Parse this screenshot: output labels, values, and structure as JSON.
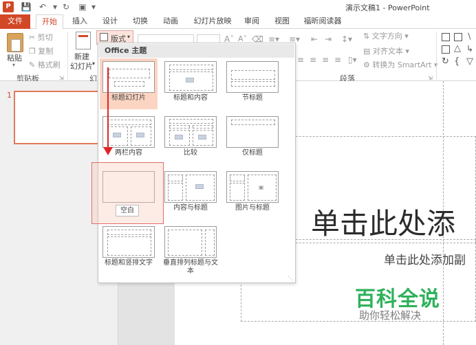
{
  "app": {
    "logo_letter": "P",
    "window_title": "演示文稿1 - PowerPoint",
    "brand_color": "#d24726"
  },
  "quick_access": {
    "save_icon": "save-icon",
    "undo_icon": "undo-icon",
    "redo_icon": "redo-icon",
    "present_icon": "start-from-beginning-icon"
  },
  "tabs": [
    {
      "label": "文件"
    },
    {
      "label": "开始"
    },
    {
      "label": "插入"
    },
    {
      "label": "设计"
    },
    {
      "label": "切换"
    },
    {
      "label": "动画"
    },
    {
      "label": "幻灯片放映"
    },
    {
      "label": "审阅"
    },
    {
      "label": "视图"
    },
    {
      "label": "福昕阅读器"
    }
  ],
  "ribbon": {
    "clipboard": {
      "paste_label": "粘贴",
      "cut_label": "剪切",
      "copy_label": "复制",
      "format_painter_label": "格式刷",
      "group_label": "剪贴板"
    },
    "slides": {
      "new_slide_label": "新建",
      "new_slide_label2": "幻灯片",
      "layout_label": "版式",
      "group_label_partial": "幻"
    },
    "paragraph": {
      "text_direction_label": "文字方向",
      "align_text_label": "对齐文本",
      "convert_smartart_label": "转换为 SmartArt",
      "group_label": "段落"
    }
  },
  "slide_panel": {
    "slide_number": "1"
  },
  "slide": {
    "title_placeholder": "单击此处添",
    "subtitle_placeholder": "单击此处添加副"
  },
  "layout_gallery": {
    "header": "Office 主题",
    "layouts": [
      {
        "label": "标题幻灯片"
      },
      {
        "label": "标题和内容"
      },
      {
        "label": "节标题"
      },
      {
        "label": "两栏内容"
      },
      {
        "label": "比较"
      },
      {
        "label": "仅标题"
      },
      {
        "label": "空白"
      },
      {
        "label": "内容与标题"
      },
      {
        "label": "图片与标题"
      },
      {
        "label": "标题和竖排文字"
      },
      {
        "label": "垂直排列标题与文本"
      }
    ],
    "tooltip": "空白"
  },
  "watermark": {
    "main": "百科全说",
    "sub": "助你轻松解决",
    "color": "#2fb15a"
  }
}
